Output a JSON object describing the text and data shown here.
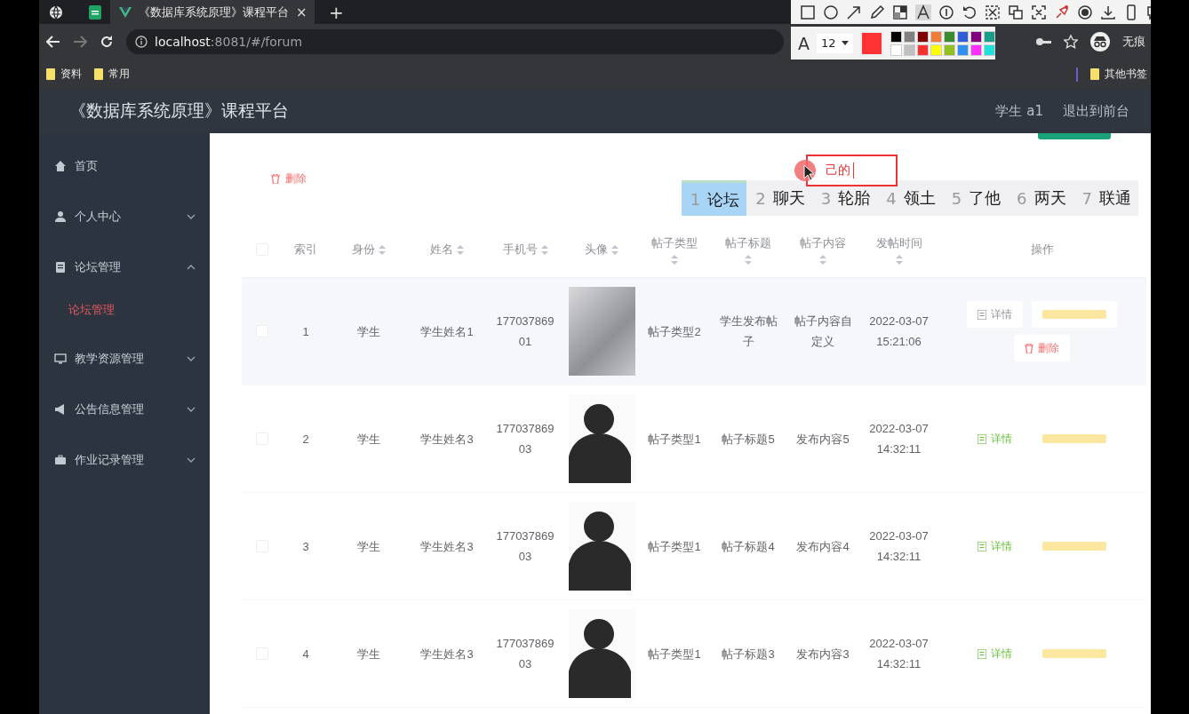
{
  "browser": {
    "tab_title": "《数据库系统原理》课程平台",
    "tab_close": "×",
    "new_tab": "+",
    "url": {
      "host": "localhost",
      "path": ":8081/#/forum"
    },
    "profile": "无痕",
    "bookmarks": [
      "资料",
      "常用"
    ],
    "other_bookmarks": "其他书签"
  },
  "annotator": {
    "tools": [
      {
        "kind": "rect",
        "selected": false
      },
      {
        "kind": "ellipse",
        "selected": false
      },
      {
        "kind": "arrow",
        "selected": false
      },
      {
        "kind": "pencil",
        "selected": false
      },
      {
        "kind": "mosaic",
        "selected": false
      },
      {
        "kind": "text",
        "selected": true
      },
      {
        "kind": "number",
        "selected": false
      },
      {
        "kind": "undo",
        "selected": false
      },
      {
        "kind": "cut",
        "selected": false
      },
      {
        "kind": "translate",
        "selected": false
      },
      {
        "kind": "capture",
        "selected": false
      },
      {
        "kind": "pin",
        "selected": false
      },
      {
        "kind": "record",
        "selected": false
      },
      {
        "kind": "download",
        "selected": false
      },
      {
        "kind": "phone",
        "selected": false
      },
      {
        "kind": "chat",
        "selected": false
      }
    ],
    "font_glyph": "A",
    "font_size": "12",
    "current": {
      "color": "#ff3333"
    },
    "palette": [
      {
        "color": "#000000"
      },
      {
        "color": "#808080"
      },
      {
        "color": "#800000"
      },
      {
        "color": "#f07c3c"
      },
      {
        "color": "#3a8a2e"
      },
      {
        "color": "#3060d8"
      },
      {
        "color": "#800080"
      },
      {
        "color": "#1a9e8a"
      },
      {
        "color": "#ffffff"
      },
      {
        "color": "#c0c0c0"
      },
      {
        "color": "#ff3030"
      },
      {
        "color": "#ffff00"
      },
      {
        "color": "#90c020"
      },
      {
        "color": "#3090f0"
      },
      {
        "color": "#ff30ff"
      },
      {
        "color": "#20e0d8"
      }
    ]
  },
  "app": {
    "title": "《数据库系统原理》课程平台",
    "user": "学生 a1",
    "logout": "退出到前台"
  },
  "sidebar": {
    "items": [
      {
        "label": "首页"
      },
      {
        "label": "个人中心",
        "expanded": false
      },
      {
        "label": "论坛管理",
        "expanded": true,
        "children": [
          {
            "label": "论坛管理",
            "selected": true
          }
        ]
      },
      {
        "label": "教学资源管理",
        "expanded": false
      },
      {
        "label": "公告信息管理",
        "expanded": false
      },
      {
        "label": "作业记录管理",
        "expanded": false
      }
    ]
  },
  "toolbar": {
    "delete": "删除"
  },
  "annotation": {
    "text": "己的"
  },
  "ime": {
    "candidates": [
      {
        "number": "1",
        "word": "论坛",
        "selected": true
      },
      {
        "number": "2",
        "word": "聊天",
        "selected": false
      },
      {
        "number": "3",
        "word": "轮胎",
        "selected": false
      },
      {
        "number": "4",
        "word": "领土",
        "selected": false
      },
      {
        "number": "5",
        "word": "了他",
        "selected": false
      },
      {
        "number": "6",
        "word": "两天",
        "selected": false
      },
      {
        "number": "7",
        "word": "联通",
        "selected": false
      }
    ]
  },
  "table": {
    "select_all": {
      "checked": false
    },
    "columns": [
      {
        "label": "索引",
        "sortable": false
      },
      {
        "label": "身份",
        "sortable": true
      },
      {
        "label": "姓名",
        "sortable": true
      },
      {
        "label": "手机号",
        "sortable": true
      },
      {
        "label": "头像",
        "sortable": true
      },
      {
        "label": "帖子类型",
        "sortable": true
      },
      {
        "label": "帖子标题",
        "sortable": true
      },
      {
        "label": "帖子内容",
        "sortable": true
      },
      {
        "label": "发帖时间",
        "sortable": true
      },
      {
        "label": "操作",
        "sortable": false
      }
    ],
    "rows": [
      {
        "checked": false,
        "hovered": true,
        "index": "1",
        "role": "学生",
        "name": "学生姓名1",
        "phone": "17703786901",
        "avatar": {
          "kind": "photo"
        },
        "post_type": "帖子类型2",
        "post_title": "学生发布帖子",
        "post_content": "帖子内容自定义",
        "posted_at": "2022-03-07 15:21:06",
        "actions": [
          {
            "kind": "detail",
            "label": "详情"
          },
          {
            "kind": "comment"
          },
          {
            "kind": "delete",
            "label": "删除"
          }
        ]
      },
      {
        "checked": false,
        "hovered": false,
        "index": "2",
        "role": "学生",
        "name": "学生姓名3",
        "phone": "17703786903",
        "avatar": {
          "kind": "silhouette"
        },
        "post_type": "帖子类型1",
        "post_title": "帖子标题5",
        "post_content": "发布内容5",
        "posted_at": "2022-03-07 14:32:11",
        "actions": [
          {
            "kind": "detail",
            "label": "详情"
          },
          {
            "kind": "comment"
          }
        ]
      },
      {
        "checked": false,
        "hovered": false,
        "index": "3",
        "role": "学生",
        "name": "学生姓名3",
        "phone": "17703786903",
        "avatar": {
          "kind": "silhouette"
        },
        "post_type": "帖子类型1",
        "post_title": "帖子标题4",
        "post_content": "发布内容4",
        "posted_at": "2022-03-07 14:32:11",
        "actions": [
          {
            "kind": "detail",
            "label": "详情"
          },
          {
            "kind": "comment"
          }
        ]
      },
      {
        "checked": false,
        "hovered": false,
        "index": "4",
        "role": "学生",
        "name": "学生姓名3",
        "phone": "17703786903",
        "avatar": {
          "kind": "silhouette"
        },
        "post_type": "帖子类型1",
        "post_title": "帖子标题3",
        "post_content": "发布内容3",
        "posted_at": "2022-03-07 14:32:11",
        "actions": [
          {
            "kind": "detail",
            "label": "详情"
          },
          {
            "kind": "comment"
          }
        ]
      }
    ]
  }
}
